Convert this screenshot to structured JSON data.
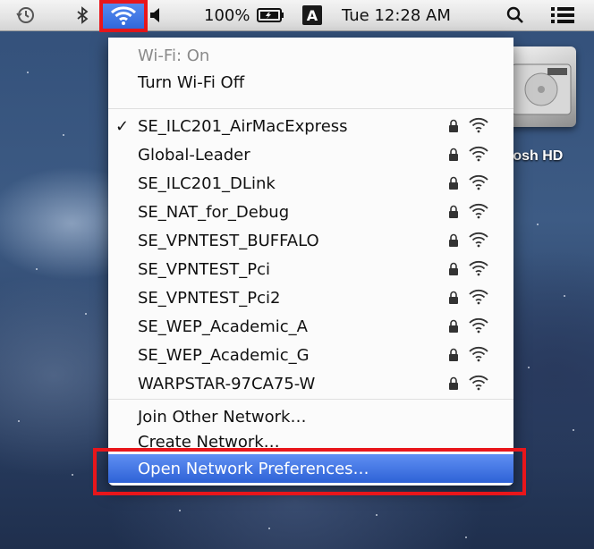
{
  "menubar": {
    "battery": "100%",
    "input_source": "A",
    "clock": "Tue 12:28 AM",
    "icons": [
      "time-machine-icon",
      "bluetooth-icon",
      "wifi-icon",
      "volume-icon",
      "battery-icon",
      "input-source-icon",
      "spotlight-icon",
      "list-icon"
    ]
  },
  "desktop": {
    "drive_label": "tosh HD"
  },
  "wifi_menu": {
    "status": "Wi-Fi: On",
    "toggle": "Turn Wi-Fi Off",
    "networks": [
      {
        "name": "SE_ILC201_AirMacExpress",
        "connected": true,
        "secured": true
      },
      {
        "name": "Global-Leader",
        "connected": false,
        "secured": true
      },
      {
        "name": "SE_ILC201_DLink",
        "connected": false,
        "secured": true
      },
      {
        "name": "SE_NAT_for_Debug",
        "connected": false,
        "secured": true
      },
      {
        "name": "SE_VPNTEST_BUFFALO",
        "connected": false,
        "secured": true
      },
      {
        "name": "SE_VPNTEST_Pci",
        "connected": false,
        "secured": true
      },
      {
        "name": "SE_VPNTEST_Pci2",
        "connected": false,
        "secured": true
      },
      {
        "name": "SE_WEP_Academic_A",
        "connected": false,
        "secured": true
      },
      {
        "name": "SE_WEP_Academic_G",
        "connected": false,
        "secured": true
      },
      {
        "name": "WARPSTAR-97CA75-W",
        "connected": false,
        "secured": true
      }
    ],
    "checkmark": "✓",
    "join_other": "Join Other Network…",
    "create_network": "Create Network…",
    "open_prefs": "Open Network Preferences…"
  },
  "colors": {
    "highlight_box": "#e8161b",
    "selection": "#2e62d6"
  }
}
